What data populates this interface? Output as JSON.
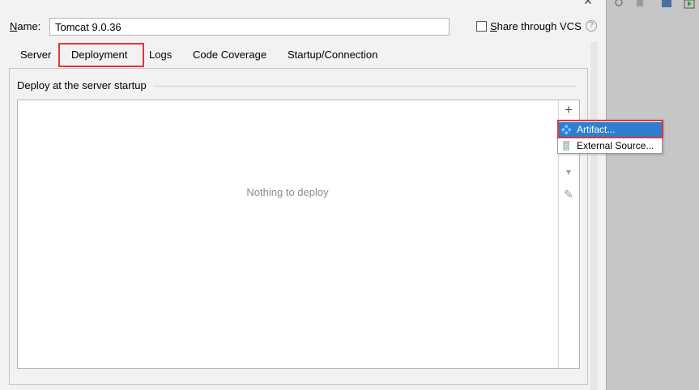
{
  "form": {
    "name_label_underlined": "N",
    "name_label_rest": "ame:",
    "name_value": "Tomcat 9.0.36",
    "share_label_underlined": "S",
    "share_label_rest": "hare through VCS",
    "share_checked": false
  },
  "tabs": [
    {
      "label": "Server",
      "active": false
    },
    {
      "label": "Deployment",
      "active": true
    },
    {
      "label": "Logs",
      "active": false
    },
    {
      "label": "Code Coverage",
      "active": false
    },
    {
      "label": "Startup/Connection",
      "active": false
    }
  ],
  "deploy": {
    "section_title": "Deploy at the server startup",
    "empty_text": "Nothing to deploy"
  },
  "toolbar": {
    "add_symbol": "+",
    "down_symbol": "▼",
    "edit_symbol": "✎"
  },
  "popup": {
    "items": [
      {
        "label": "Artifact...",
        "icon": "artifact-icon",
        "selected": true
      },
      {
        "label": "External Source...",
        "icon": "external-source-icon",
        "selected": false
      }
    ]
  },
  "colors": {
    "highlight_red": "#e0353b",
    "selection_blue": "#2f7fd1",
    "background": "#f2f2f2"
  }
}
